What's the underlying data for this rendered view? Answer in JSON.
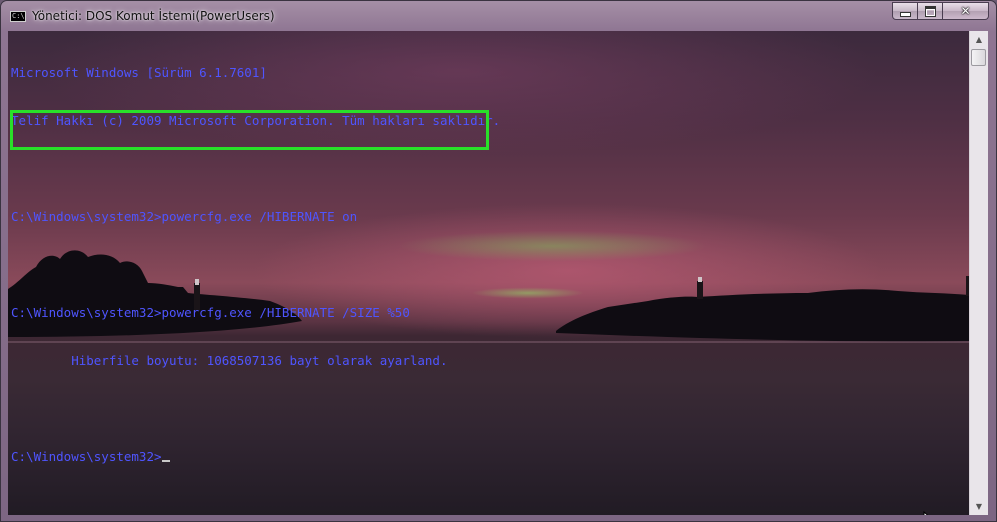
{
  "window": {
    "title": "Yönetici: DOS Komut İstemi(PowerUsers)",
    "icon_label": "C:\\",
    "icon": "console-icon",
    "caption_buttons": {
      "minimize": "—",
      "maximize": "□",
      "close": "✕"
    }
  },
  "console": {
    "line1": "Microsoft Windows [Sürüm 6.1.7601]",
    "line2": "Telif Hakkı (c) 2009 Microsoft Corporation. Tüm hakları saklıdır.",
    "line3": "C:\\Windows\\system32>powercfg.exe /HIBERNATE on",
    "line4": "C:\\Windows\\system32>powercfg.exe /HIBERNATE /SIZE %50",
    "line5": "        Hiberfile boyutu: 1068507136 bayt olarak ayarland.",
    "prompt": "C:\\Windows\\system32>",
    "text_color": "#4f55ff",
    "highlight_color": "#29e029"
  },
  "scrollbar": {
    "up_arrow": "▲",
    "down_arrow": "▼",
    "position": 0
  },
  "icons": [
    "console-icon",
    "minimize-icon",
    "maximize-icon",
    "close-icon",
    "scroll-up-icon",
    "scroll-down-icon",
    "mouse-pointer-icon"
  ]
}
